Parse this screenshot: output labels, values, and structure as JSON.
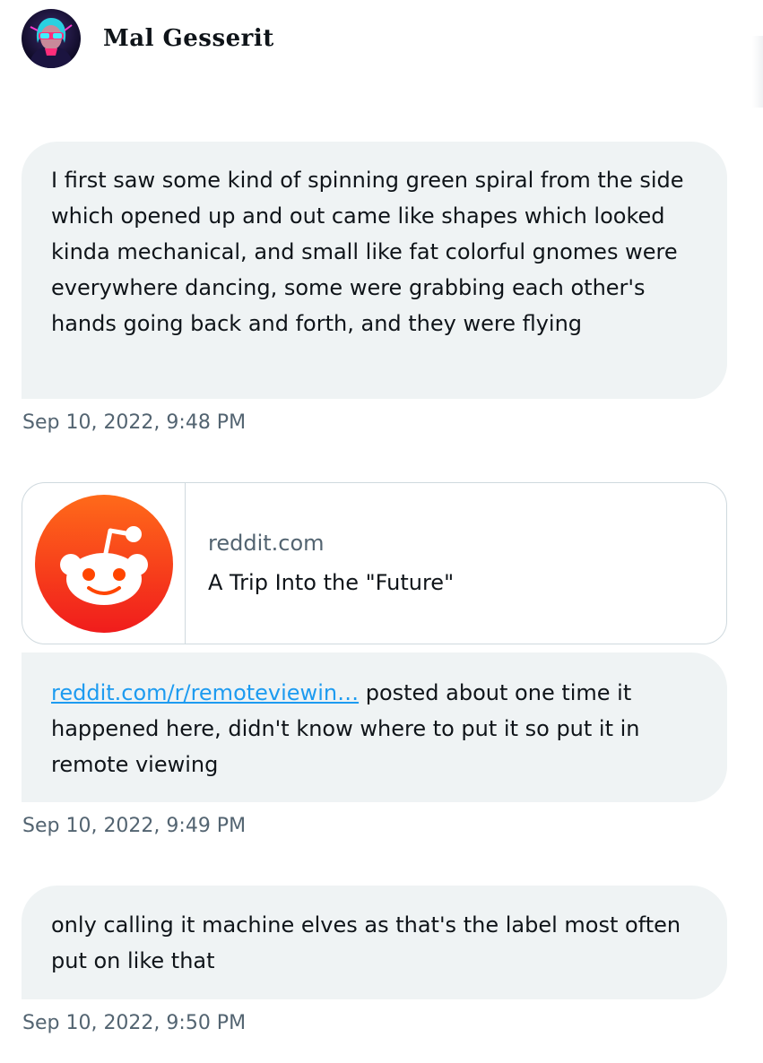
{
  "user": {
    "display_name": "Mal Gesserit",
    "avatar_icon": "user-avatar-icon"
  },
  "messages": [
    {
      "text": "I first saw some kind of spinning green spiral from the side which opened up and out came like shapes which looked kinda mechanical, and small like fat colorful gnomes were everywhere dancing, some were grabbing each other's hands going back and forth, and they were flying",
      "timestamp": "Sep 10, 2022, 9:48 PM"
    },
    {
      "link_card": {
        "domain": "reddit.com",
        "title": "A Trip Into the \"Future\"",
        "icon": "reddit-logo-icon"
      },
      "link_text": "reddit.com/r/remoteviewin…",
      "text": " posted about one time it happened here, didn't know where to put it so put it in remote viewing",
      "timestamp": "Sep 10, 2022, 9:49 PM"
    },
    {
      "text": "only calling it machine elves as that's the label most often put on like that",
      "timestamp": "Sep 10, 2022, 9:50 PM"
    }
  ],
  "colors": {
    "bubble_bg": "#eff3f4",
    "link": "#1d9bf0",
    "timestamp": "#536471",
    "reddit_orange": "#ff4500"
  }
}
